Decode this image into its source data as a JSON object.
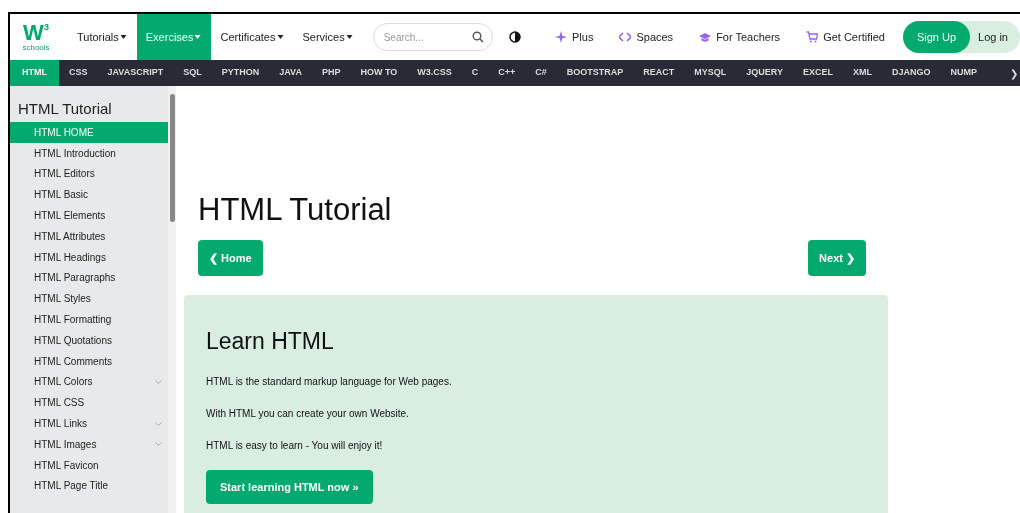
{
  "nav": {
    "logo": {
      "letter": "W",
      "sup": "3",
      "caption": "schools"
    },
    "menu": [
      {
        "label": "Tutorials",
        "selected": false
      },
      {
        "label": "Exercises",
        "selected": true
      },
      {
        "label": "Certificates",
        "selected": false
      },
      {
        "label": "Services",
        "selected": false
      }
    ],
    "search": {
      "placeholder": "Search..."
    },
    "links": [
      {
        "label": "Plus",
        "kind": "sparkle"
      },
      {
        "label": "Spaces",
        "kind": "code"
      },
      {
        "label": "For Teachers",
        "kind": "cap"
      },
      {
        "label": "Get Certified",
        "kind": "cart"
      }
    ],
    "sign_up": "Sign Up",
    "log_in": "Log in"
  },
  "subnav": {
    "items": [
      {
        "label": "HTML",
        "selected": true
      },
      {
        "label": "CSS",
        "selected": false
      },
      {
        "label": "JAVASCRIPT",
        "selected": false
      },
      {
        "label": "SQL",
        "selected": false
      },
      {
        "label": "PYTHON",
        "selected": false
      },
      {
        "label": "JAVA",
        "selected": false
      },
      {
        "label": "PHP",
        "selected": false
      },
      {
        "label": "HOW TO",
        "selected": false
      },
      {
        "label": "W3.CSS",
        "selected": false
      },
      {
        "label": "C",
        "selected": false
      },
      {
        "label": "C++",
        "selected": false
      },
      {
        "label": "C#",
        "selected": false
      },
      {
        "label": "BOOTSTRAP",
        "selected": false
      },
      {
        "label": "REACT",
        "selected": false
      },
      {
        "label": "MYSQL",
        "selected": false
      },
      {
        "label": "JQUERY",
        "selected": false
      },
      {
        "label": "EXCEL",
        "selected": false
      },
      {
        "label": "XML",
        "selected": false
      },
      {
        "label": "DJANGO",
        "selected": false
      },
      {
        "label": "NUMP",
        "selected": false
      }
    ],
    "more": "❯"
  },
  "sidebar": {
    "title": "HTML Tutorial",
    "items": [
      {
        "label": "HTML HOME",
        "selected": true,
        "expandable": false
      },
      {
        "label": "HTML Introduction",
        "selected": false,
        "expandable": false
      },
      {
        "label": "HTML Editors",
        "selected": false,
        "expandable": false
      },
      {
        "label": "HTML Basic",
        "selected": false,
        "expandable": false
      },
      {
        "label": "HTML Elements",
        "selected": false,
        "expandable": false
      },
      {
        "label": "HTML Attributes",
        "selected": false,
        "expandable": false
      },
      {
        "label": "HTML Headings",
        "selected": false,
        "expandable": false
      },
      {
        "label": "HTML Paragraphs",
        "selected": false,
        "expandable": false
      },
      {
        "label": "HTML Styles",
        "selected": false,
        "expandable": false
      },
      {
        "label": "HTML Formatting",
        "selected": false,
        "expandable": false
      },
      {
        "label": "HTML Quotations",
        "selected": false,
        "expandable": false
      },
      {
        "label": "HTML Comments",
        "selected": false,
        "expandable": false
      },
      {
        "label": "HTML Colors",
        "selected": false,
        "expandable": true
      },
      {
        "label": "HTML CSS",
        "selected": false,
        "expandable": false
      },
      {
        "label": "HTML Links",
        "selected": false,
        "expandable": true
      },
      {
        "label": "HTML Images",
        "selected": false,
        "expandable": true
      },
      {
        "label": "HTML Favicon",
        "selected": false,
        "expandable": false
      },
      {
        "label": "HTML Page Title",
        "selected": false,
        "expandable": false
      }
    ]
  },
  "main": {
    "title": "HTML Tutorial",
    "prev": "❮ Home",
    "next": "Next ❯",
    "panel": {
      "heading": "Learn HTML",
      "paragraphs": [
        "HTML is the standard markup language for Web pages.",
        "With HTML you can create your own Website.",
        "HTML is easy to learn - You will enjoy it!"
      ],
      "button": "Start learning HTML now »"
    }
  }
}
